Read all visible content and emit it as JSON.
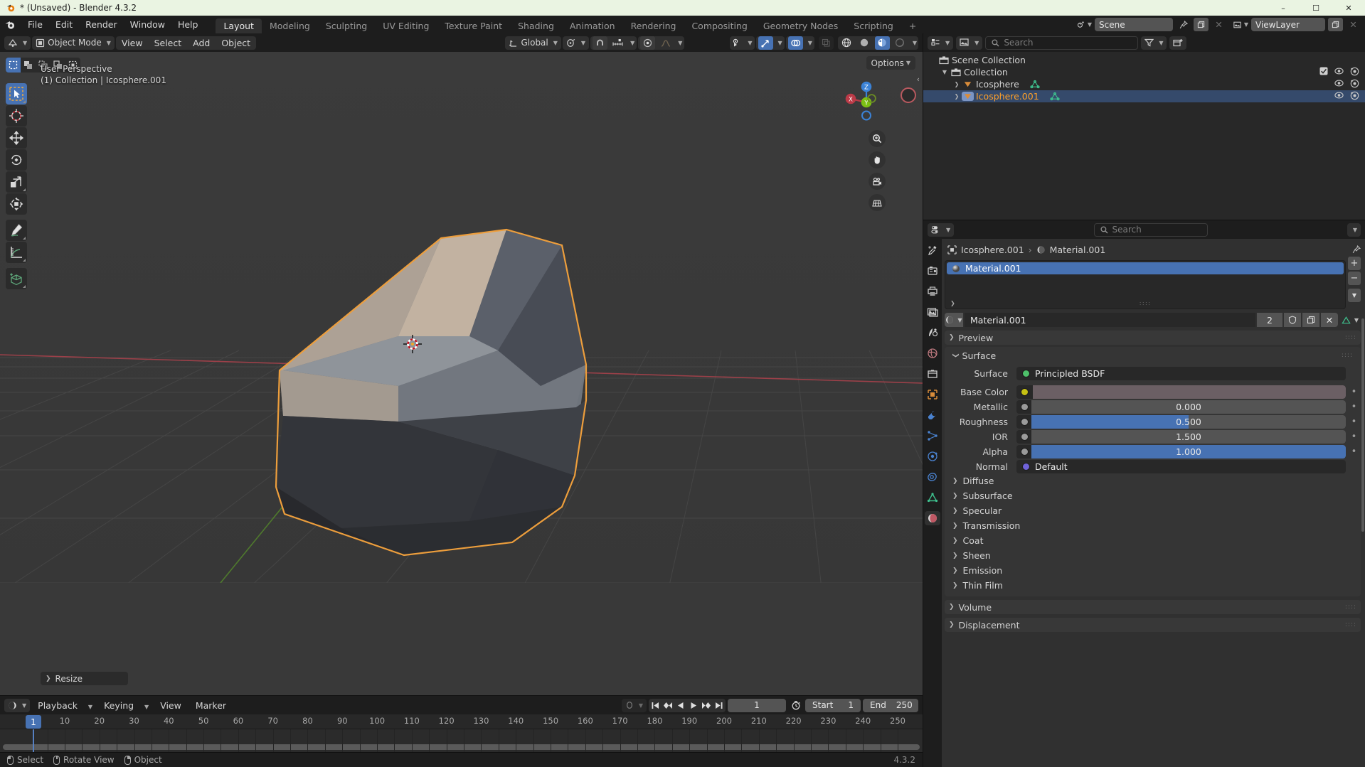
{
  "window": {
    "title": "* (Unsaved) - Blender 4.3.2",
    "minimize": "–",
    "maximize": "☐",
    "close": "✕"
  },
  "topbar": {
    "menus": [
      "File",
      "Edit",
      "Render",
      "Window",
      "Help"
    ],
    "workspaces": [
      {
        "label": "Layout",
        "active": true
      },
      {
        "label": "Modeling",
        "active": false
      },
      {
        "label": "Sculpting",
        "active": false
      },
      {
        "label": "UV Editing",
        "active": false
      },
      {
        "label": "Texture Paint",
        "active": false
      },
      {
        "label": "Shading",
        "active": false
      },
      {
        "label": "Animation",
        "active": false
      },
      {
        "label": "Rendering",
        "active": false
      },
      {
        "label": "Compositing",
        "active": false
      },
      {
        "label": "Geometry Nodes",
        "active": false
      },
      {
        "label": "Scripting",
        "active": false
      }
    ],
    "add_workspace": "+",
    "scene_name": "Scene",
    "viewlayer_name": "ViewLayer"
  },
  "viewport_header": {
    "mode": "Object Mode",
    "menus": [
      "View",
      "Select",
      "Add",
      "Object"
    ],
    "transform_orientation": "Global",
    "options_label": "Options"
  },
  "viewport": {
    "perspective": "User Perspective",
    "collection_line": "(1) Collection | Icosphere.001",
    "operator_panel": "Resize",
    "gizmo_axes": {
      "x": "X",
      "y": "Y",
      "z": "Z"
    },
    "colors": {
      "background": "#393939",
      "selection_outline": "#ed9e3c",
      "x_axis": "#9c4049",
      "y_axis": "#4f7a2d",
      "accent_blue": "#4772b3"
    }
  },
  "toolbar": {
    "select_modes": [
      "select-box",
      "select-extend",
      "select-subtract",
      "select-invert",
      "select-intersect"
    ],
    "tools": [
      {
        "name": "tweak-select-box",
        "active": true
      },
      {
        "name": "cursor",
        "active": false
      },
      {
        "name": "move",
        "active": false
      },
      {
        "name": "rotate",
        "active": false
      },
      {
        "name": "scale",
        "active": false
      },
      {
        "name": "transform",
        "active": false
      },
      {
        "name": "annotate",
        "active": false
      },
      {
        "name": "measure",
        "active": false
      },
      {
        "name": "add-cube",
        "active": false
      }
    ]
  },
  "outliner": {
    "search_placeholder": "Search",
    "rows": [
      {
        "label": "Scene Collection",
        "icon": "collection-icon",
        "depth": 0,
        "expandable": false,
        "selected": false,
        "checkbox": false,
        "eye": false,
        "camera": false
      },
      {
        "label": "Collection",
        "icon": "collection-icon",
        "depth": 1,
        "expandable": true,
        "expanded": true,
        "selected": false,
        "checkbox": true,
        "eye": true,
        "camera": true
      },
      {
        "label": "Icosphere",
        "icon": "mesh-object-icon",
        "depth": 2,
        "expandable": true,
        "expanded": false,
        "selected": false,
        "checkbox": false,
        "eye": true,
        "camera": true,
        "data_icon": "mesh-data-icon"
      },
      {
        "label": "Icosphere.001",
        "icon": "mesh-object-icon",
        "depth": 2,
        "expandable": true,
        "expanded": false,
        "selected": true,
        "checkbox": false,
        "eye": true,
        "camera": true,
        "data_icon": "mesh-data-icon"
      }
    ]
  },
  "properties": {
    "search_placeholder": "Search",
    "breadcrumb": {
      "object": "Icosphere.001",
      "separator": "›",
      "material": "Material.001"
    },
    "material_slots": [
      {
        "name": "Material.001",
        "selected": true
      }
    ],
    "material_id": {
      "name": "Material.001",
      "users": "2"
    },
    "panels": [
      {
        "label": "Preview",
        "expanded": false
      },
      {
        "label": "Surface",
        "expanded": true
      }
    ],
    "surface": {
      "shader_label": "Surface",
      "shader_value": "Principled BSDF",
      "fields": [
        {
          "label": "Base Color",
          "type": "color",
          "value": "",
          "socket": "#c6c114",
          "swatch": "#6b5f64"
        },
        {
          "label": "Metallic",
          "type": "slider",
          "value": "0.000",
          "fill": 0,
          "socket": "#9a9a9a"
        },
        {
          "label": "Roughness",
          "type": "slider",
          "value": "0.500",
          "fill": 50,
          "socket": "#9a9a9a"
        },
        {
          "label": "IOR",
          "type": "slider",
          "value": "1.500",
          "fill": 0,
          "socket": "#9a9a9a"
        },
        {
          "label": "Alpha",
          "type": "slider",
          "value": "1.000",
          "fill": 100,
          "socket": "#9a9a9a"
        },
        {
          "label": "Normal",
          "type": "enum",
          "value": "Default",
          "socket": "#6f62d8"
        }
      ],
      "subpanels": [
        "Diffuse",
        "Subsurface",
        "Specular",
        "Transmission",
        "Coat",
        "Sheen",
        "Emission",
        "Thin Film"
      ]
    },
    "bottom_panels": [
      {
        "label": "Volume",
        "expanded": false
      },
      {
        "label": "Displacement",
        "expanded": false
      }
    ],
    "tabs": [
      {
        "name": "tool-tab",
        "active": false
      },
      {
        "name": "render-tab",
        "active": false
      },
      {
        "name": "output-tab",
        "active": false
      },
      {
        "name": "view-layer-tab",
        "active": false
      },
      {
        "name": "scene-tab",
        "active": false
      },
      {
        "name": "world-tab",
        "active": false
      },
      {
        "name": "collection-tab",
        "active": false
      },
      {
        "name": "object-tab",
        "active": false
      },
      {
        "name": "modifier-tab",
        "active": false
      },
      {
        "name": "particles-tab",
        "active": false
      },
      {
        "name": "physics-tab",
        "active": false
      },
      {
        "name": "constraints-tab",
        "active": false
      },
      {
        "name": "object-data-tab",
        "active": false
      },
      {
        "name": "material-tab",
        "active": true
      }
    ]
  },
  "timeline": {
    "editor_menus": [
      "Playback",
      "Keying",
      "View",
      "Marker"
    ],
    "current_frame": "1",
    "start_label": "Start",
    "start_value": "1",
    "end_label": "End",
    "end_value": "250",
    "ruler_ticks": [
      1,
      10,
      20,
      30,
      40,
      50,
      60,
      70,
      80,
      90,
      100,
      110,
      120,
      130,
      140,
      150,
      160,
      170,
      180,
      190,
      200,
      210,
      220,
      230,
      240,
      250
    ],
    "playhead_frame": 1
  },
  "statusbar": {
    "items": [
      {
        "mouse": "left",
        "label": "Select"
      },
      {
        "mouse": "middle",
        "label": "Rotate View"
      },
      {
        "mouse": "right",
        "label": "Object"
      }
    ],
    "version": "4.3.2"
  }
}
